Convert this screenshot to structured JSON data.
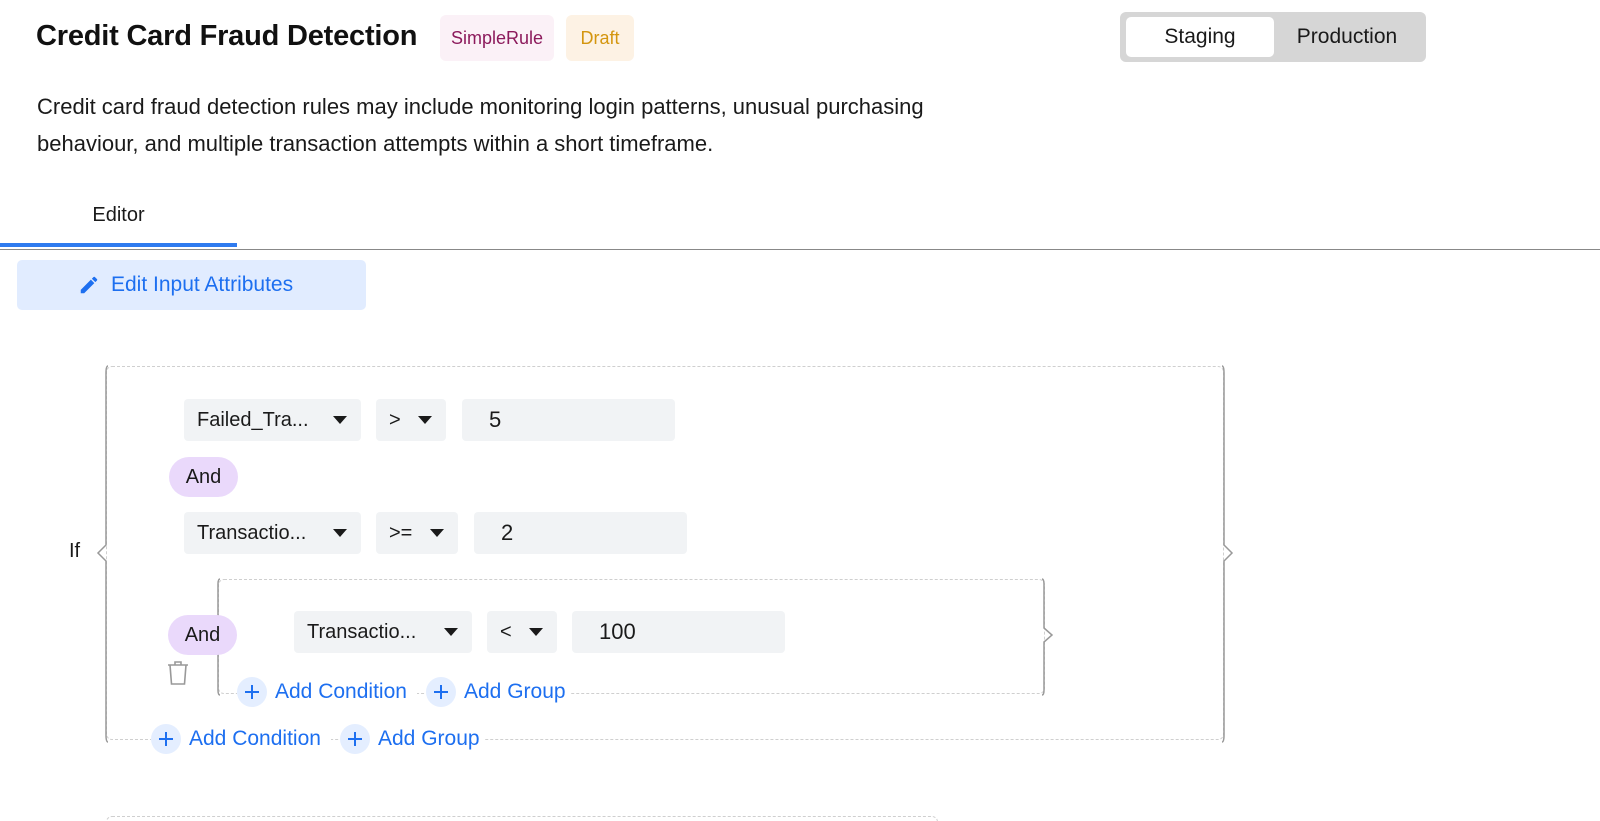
{
  "header": {
    "title": "Credit Card Fraud Detection",
    "badges": [
      {
        "label": "SimpleRule",
        "color": "#8c1a5c",
        "bg": "#fbf1f7"
      },
      {
        "label": "Draft",
        "color": "#d4960f",
        "bg": "#fdf2e4"
      }
    ],
    "environment": {
      "options": [
        "Staging",
        "Production"
      ],
      "selected": "Staging"
    }
  },
  "description": "Credit card fraud detection rules may include monitoring login patterns, unusual purchasing behaviour, and multiple transaction attempts within a short timeframe.",
  "tabs": [
    {
      "label": "Editor",
      "active": true
    }
  ],
  "editor": {
    "edit_attributes_label": "Edit Input Attributes",
    "if_label": "If",
    "conditions": [
      {
        "attribute": "Failed_Tra...",
        "operator": ">",
        "value": "5"
      },
      {
        "attribute": "Transactio...",
        "operator": ">=",
        "value": "2"
      }
    ],
    "connectors": [
      "And",
      "And"
    ],
    "nested_group": {
      "conditions": [
        {
          "attribute": "Transactio...",
          "operator": "<",
          "value": "100"
        }
      ],
      "add_condition_label": "Add Condition",
      "add_group_label": "Add Group"
    },
    "add_condition_label": "Add Condition",
    "add_group_label": "Add Group"
  },
  "colors": {
    "accent": "#1d6ff0",
    "tab_underline": "#2f7bef",
    "connector_bg": "#ead9fb",
    "edit_button_bg": "#e1ecff"
  }
}
